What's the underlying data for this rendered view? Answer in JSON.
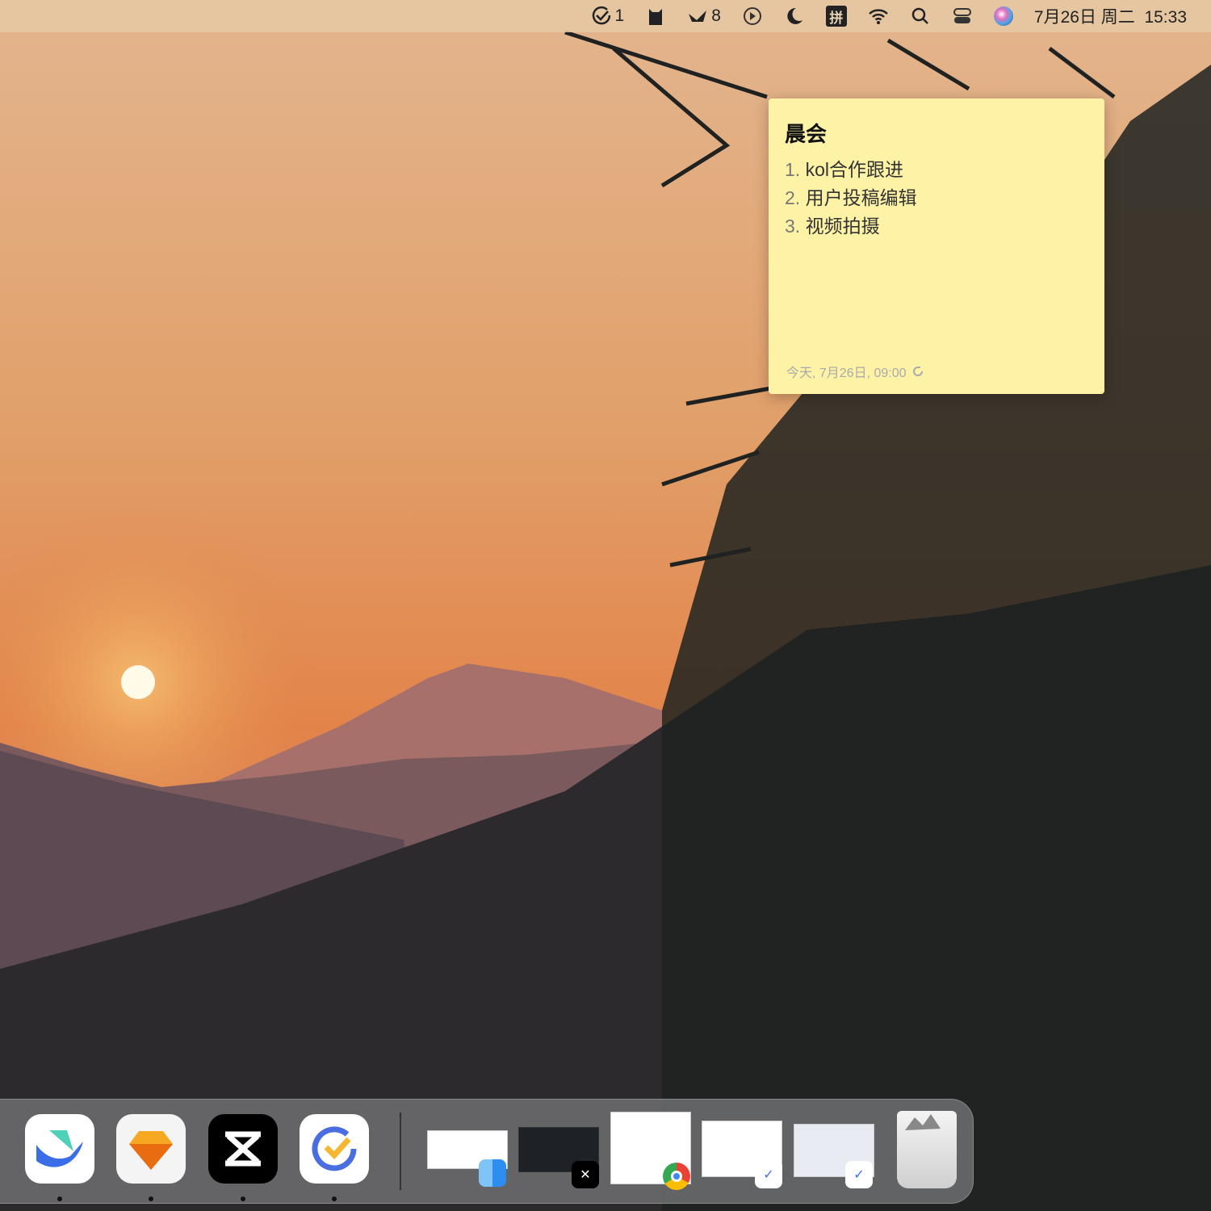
{
  "menubar": {
    "ticktick_count": "1",
    "notif_count": "8",
    "input_method": "拼",
    "datetime": "7月26日 周二  15:33"
  },
  "note": {
    "title": "晨会",
    "items": [
      {
        "num": "1.",
        "text": "kol合作跟进"
      },
      {
        "num": "2.",
        "text": "用户投稿编辑"
      },
      {
        "num": "3.",
        "text": "视频拍摄"
      }
    ],
    "timestamp": "今天, 7月26日, 09:00"
  },
  "dock": {
    "apps": [
      "Lark",
      "Sketch",
      "CapCut",
      "TickTick"
    ],
    "minimized": [
      "Finder window",
      "CapCut window",
      "Chrome window",
      "TickTick window",
      "Lark window"
    ],
    "trash": "Trash"
  }
}
